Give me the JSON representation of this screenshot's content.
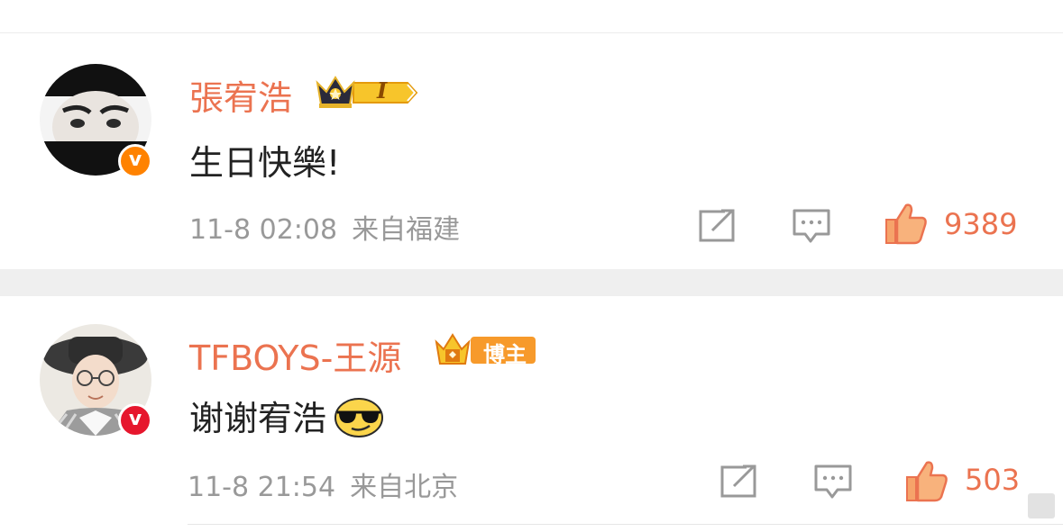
{
  "comments": [
    {
      "username": "張宥浩",
      "level_badge": "I",
      "content": "生日快樂!",
      "time": "11-8 02:08",
      "location": "来自福建",
      "likes": "9389"
    },
    {
      "username": "TFBOYS-王源",
      "badge_label": "博主",
      "content": "谢谢宥浩",
      "time": "11-8 21:54",
      "location": "来自北京",
      "likes": "503"
    }
  ],
  "verified_mark": "v",
  "colors": {
    "accent": "#eb7350",
    "verified": "#ff8200",
    "meta_text": "#999999",
    "separator": "#efefef"
  }
}
